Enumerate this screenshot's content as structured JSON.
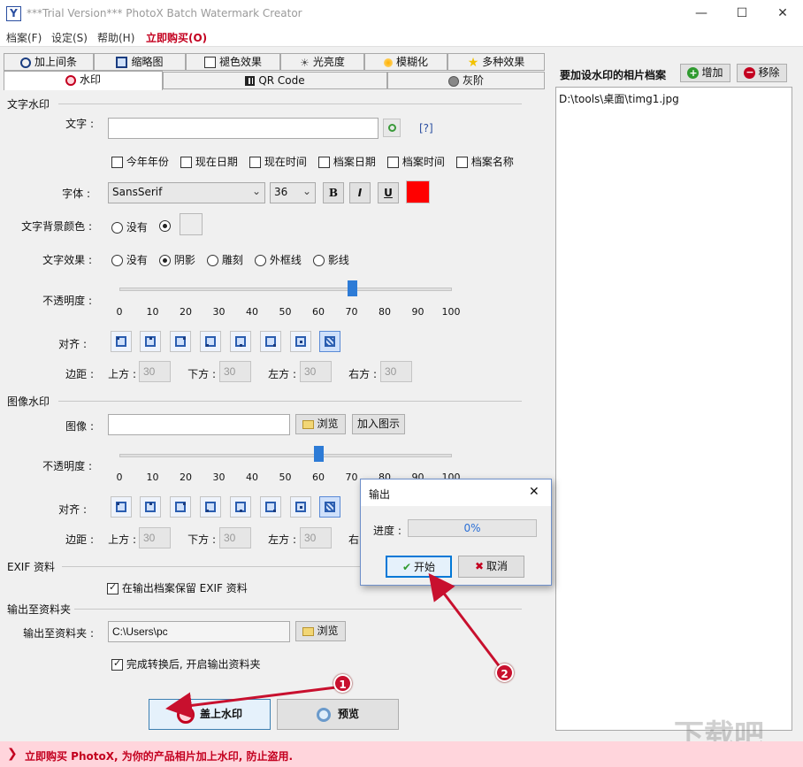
{
  "window": {
    "title": "***Trial Version*** PhotoX Batch Watermark Creator",
    "app_icon": "Y",
    "minimize_glyph": "—",
    "maximize_glyph": "☐",
    "close_glyph": "✕"
  },
  "menu": {
    "file": "档案(F)",
    "settings": "设定(S)",
    "help": "帮助(H)",
    "buy": "立即购买(O)"
  },
  "tabs_top": [
    "加上间条",
    "缩略图",
    "褪色效果",
    "光亮度",
    "模糊化",
    "多种效果"
  ],
  "tabs_bottom": [
    "水印",
    "QR Code",
    "灰阶"
  ],
  "text_watermark": {
    "section": "文字水印",
    "text_label": "文字 :",
    "text_value": "",
    "help_link": "[?]",
    "checkboxes": [
      "今年年份",
      "现在日期",
      "现在时间",
      "档案日期",
      "档案时间",
      "档案名称"
    ],
    "font_label": "字体 :",
    "font_value": "SansSerif",
    "size_value": "36",
    "bold": "B",
    "italic": "I",
    "underline": "U",
    "color": "#ff0000",
    "bg_label": "文字背景颜色 :",
    "bg_none": "没有",
    "effect_label": "文字效果 :",
    "effects": [
      "没有",
      "阴影",
      "雕刻",
      "外框线",
      "影线"
    ],
    "opacity_label": "不透明度 :",
    "opacity_value": 70,
    "ticks": [
      "0",
      "10",
      "20",
      "30",
      "40",
      "50",
      "60",
      "70",
      "80",
      "90",
      "100"
    ],
    "align_label": "对齐 :",
    "margin_label": "边距 :",
    "margins": [
      {
        "label": "上方 :",
        "value": "30"
      },
      {
        "label": "下方 :",
        "value": "30"
      },
      {
        "label": "左方 :",
        "value": "30"
      },
      {
        "label": "右方 :",
        "value": "30"
      }
    ]
  },
  "image_watermark": {
    "section": "图像水印",
    "image_label": "图像 :",
    "image_value": "",
    "browse": "浏览",
    "add_icon": "加入图示",
    "opacity_label": "不透明度 :",
    "opacity_value": 60,
    "ticks": [
      "0",
      "10",
      "20",
      "30",
      "40",
      "50",
      "60",
      "70",
      "80",
      "90",
      "100"
    ],
    "align_label": "对齐 :",
    "margin_label": "边距 :",
    "margins": [
      {
        "label": "上方 :",
        "value": "30"
      },
      {
        "label": "下方 :",
        "value": "30"
      },
      {
        "label": "左方 :",
        "value": "30"
      },
      {
        "label": "右",
        "value": ""
      }
    ]
  },
  "exif": {
    "section": "EXIF 资料",
    "keep": "在输出档案保留 EXIF 资料"
  },
  "output": {
    "section": "输出至资料夹",
    "label": "输出至资料夹 :",
    "value": "C:\\Users\\pc",
    "browse": "浏览",
    "open_after": "完成转换后, 开启输出资料夹"
  },
  "actions": {
    "apply": "盖上水印",
    "preview": "预览"
  },
  "right": {
    "title": "要加设水印的相片档案",
    "add": "增加",
    "remove": "移除",
    "files": [
      "D:\\tools\\桌面\\timg1.jpg"
    ]
  },
  "status": {
    "text": "立即购买 PhotoX, 为你的产品相片加上水印, 防止盗用."
  },
  "dialog": {
    "title": "输出",
    "progress_label": "进度 :",
    "progress_text": "0%",
    "progress_value": 0,
    "start": "开始",
    "cancel": "取消"
  },
  "annotations": [
    "1",
    "2"
  ],
  "watermark_logo": "下载吧"
}
